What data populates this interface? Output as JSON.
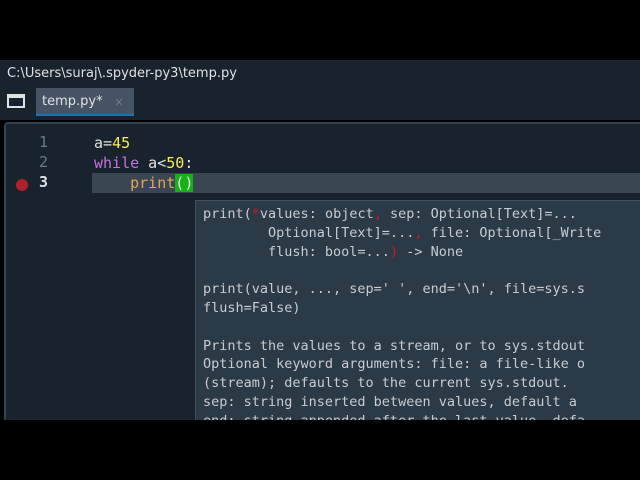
{
  "path": "C:\\Users\\suraj\\.spyder-py3\\temp.py",
  "tab": {
    "label": "temp.py*",
    "close": "×"
  },
  "lines": [
    "1",
    "2",
    "3"
  ],
  "code": {
    "l1": {
      "a": "a=",
      "b": "45"
    },
    "l2": {
      "kw": "while",
      "a": " a<",
      "num": "50",
      ":": ":"
    },
    "l3": {
      "indent": "    ",
      "fn": "print",
      "open": "(",
      "close": ")"
    }
  },
  "tooltip": {
    "sig1": "print(",
    "sig1b": "*",
    "sig1c": "values: object",
    "sig1d": ", ",
    "sig1e": "sep: Optional[Text]=...",
    "sig2": "        Optional[Text]=...",
    "sig2b": ", ",
    "sig2c": "file: Optional[_Write",
    "sig3": "        flush: bool=...",
    "sig3b": ")",
    "sig3c": " -> None",
    "doc": [
      "print(value, ..., sep=' ', end='\\n', file=sys.s",
      "flush=False)",
      "",
      "Prints the values to a stream, or to sys.stdout",
      "Optional keyword arguments: file: a file-like o",
      "(stream); defaults to the current sys.stdout.",
      "sep: string inserted between values, default a",
      "end: string appended after the last value, defa"
    ]
  }
}
